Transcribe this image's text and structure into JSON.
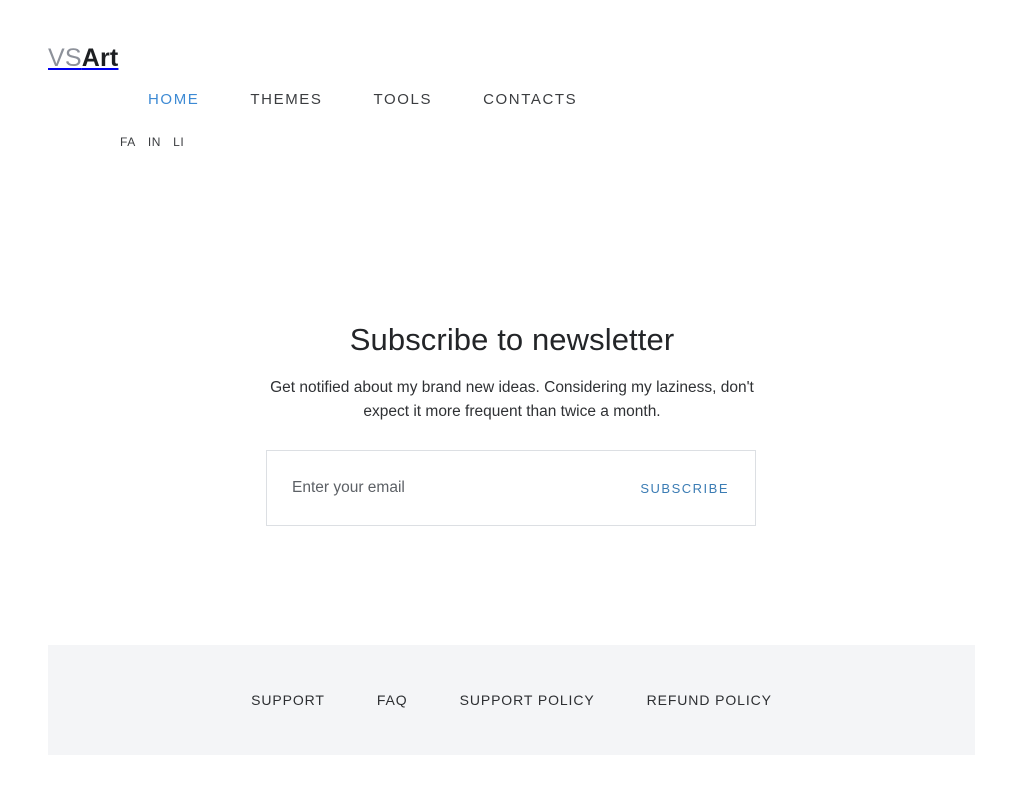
{
  "header": {
    "brand": {
      "part_one": "VS",
      "part_two": "Art",
      "part_one_color": "#8d919a",
      "part_two_color": "#1d1f22"
    },
    "nav": {
      "active_accent_color": "#3d8ad4",
      "items": [
        {
          "label": "HOME",
          "active": true
        },
        {
          "label": "THEMES",
          "active": false
        },
        {
          "label": "TOOLS",
          "active": false
        },
        {
          "label": "CONTACTS",
          "active": false
        }
      ]
    },
    "social": {
      "note": "labels are clipped by their container",
      "items": [
        {
          "label": "FA"
        },
        {
          "label": "IN"
        },
        {
          "label": "LI"
        }
      ]
    }
  },
  "main": {
    "newsletter": {
      "title": "Subscribe to newsletter",
      "description": "Get notified about my brand new ideas. Considering my laziness, don't expect it more frequent than twice a month.",
      "form": {
        "email_placeholder": "Enter your email",
        "email_value": "",
        "submit_label": "SUBSCRIBE",
        "submit_color": "#3b7cb4",
        "border_color": "#dcdfe3"
      }
    }
  },
  "footer": {
    "background_color": "#f4f5f7",
    "links": [
      {
        "label": "SUPPORT"
      },
      {
        "label": "FAQ"
      },
      {
        "label": "SUPPORT POLICY"
      },
      {
        "label": "REFUND POLICY"
      }
    ]
  }
}
